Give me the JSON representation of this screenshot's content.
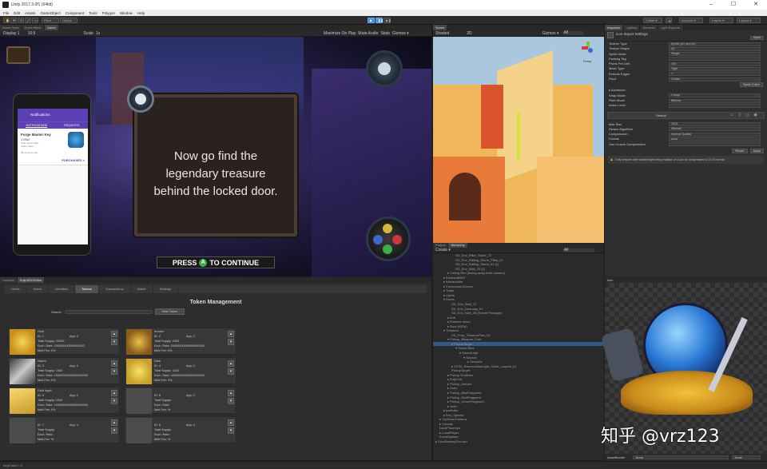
{
  "window": {
    "title": "Unity 2017.3.0f1 (64bit)"
  },
  "menu": [
    "File",
    "Edit",
    "Assets",
    "GameObject",
    "Component",
    "Tools",
    "Polygon",
    "Window",
    "Help"
  ],
  "toolbar": {
    "pivot": "Pivot",
    "global": "Global",
    "collab": "Collab ▾",
    "account": "Account ▾",
    "layers": "Layers ▾",
    "layout": "Layout ▾"
  },
  "tabs_left": [
    "Asset Store",
    "Audio Mixer",
    "Game"
  ],
  "game": {
    "display": "Display 1",
    "aspect": "16:9",
    "scale": "Scale",
    "scale_value": "1x",
    "options": [
      "Maximize On Play",
      "Mute Audio",
      "Stats",
      "Gizmos ▾"
    ],
    "dialog_lines": [
      "Now go find the",
      "legendary treasure",
      "behind the locked door."
    ],
    "press_prefix": "PRESS",
    "press_button": "A",
    "press_suffix": "TO CONTINUE",
    "phone": {
      "title": "Notifications",
      "tabs": [
        "NOTIFICATIONS",
        "REQUESTS"
      ],
      "item_title": "Forge Master Key",
      "item_price": "1 ENJ",
      "item_line1": "Hide Game Filter",
      "item_line2": "Settle value",
      "time": "48 seconds ago",
      "status": "PURCHASED >"
    }
  },
  "scene": {
    "tab": "Scene",
    "mode": "Shaded",
    "view2d": "2D",
    "gizmos": "Gizmos ▾",
    "search": "All",
    "persp": "Persp"
  },
  "inspector": {
    "tab": "Inspector",
    "tab2": "Lighting",
    "tab3": "Services",
    "tab4": "Light Explorer",
    "title": "icon Import Settings",
    "open": "Open",
    "rows": [
      {
        "label": "Texture Type",
        "value": "Sprite (2D and UI)"
      },
      {
        "label": "Texture Shape",
        "value": "2D"
      },
      {
        "label": "Sprite Mode",
        "value": "Single"
      },
      {
        "label": "Packing Tag",
        "value": ""
      },
      {
        "label": "Pixels Per Unit",
        "value": "100"
      },
      {
        "label": "Mesh Type",
        "value": "Tight"
      },
      {
        "label": "Extrude Edges",
        "value": "1"
      },
      {
        "label": "Pivot",
        "value": "Center"
      }
    ],
    "sprite_editor": "Sprite Editor",
    "advanced": "▸ Advanced",
    "rows2": [
      {
        "label": "Wrap Mode",
        "value": "Clamp"
      },
      {
        "label": "Filter Mode",
        "value": "Bilinear"
      },
      {
        "label": "Aniso Level",
        "value": ""
      }
    ],
    "default": "Default",
    "rows3": [
      {
        "label": "Max Size",
        "value": "1024"
      },
      {
        "label": "Resize Algorithm",
        "value": "Mitchell"
      },
      {
        "label": "Compression",
        "value": "Normal Quality"
      },
      {
        "label": "Format",
        "value": "Auto"
      },
      {
        "label": "Use Crunch Compression",
        "value": ""
      }
    ],
    "revert": "Revert",
    "apply": "Apply",
    "warning": "Only textures with width/height being multiple of 4 can be compressed to DXT5 format",
    "preview_label": "icon",
    "assetbundle": "AssetBundle",
    "assetbundle_value": "None",
    "assetbundle_value2": "None"
  },
  "hierarchy": {
    "tab": "Project",
    "tab2": "Hierarchy",
    "create": "Create ▾",
    "search": "All",
    "rows": [
      {
        "t": "SD_Env_Pillar_Stone_72",
        "i": 5
      },
      {
        "t": "SD_Env_Railing_Stone_Pillar_01",
        "i": 5
      },
      {
        "t": "SD_Env_Railing_Stone_01 (1)",
        "i": 5
      },
      {
        "t": "SD_Env_Wall_70 (1)",
        "i": 5
      },
      {
        "t": "▸ Ceiling Rim (facing away from camera)",
        "i": 3
      },
      {
        "t": "▸ EnchantMINT",
        "i": 2
      },
      {
        "t": "▸ Interactable",
        "i": 2
      },
      {
        "t": "▸ EnvironmentZones",
        "i": 2
      },
      {
        "t": "▸ Traps",
        "i": 2
      },
      {
        "t": "▸ Lights",
        "i": 2
      },
      {
        "t": "▾ Doors",
        "i": 2
      },
      {
        "t": "SD_Env_Wall_74",
        "i": 4
      },
      {
        "t": "SD_Env_Doorway_01",
        "i": 4
      },
      {
        "t": "SD_Env_Wall_36 (Secret Passage)",
        "i": 4
      },
      {
        "t": "▸ Exit",
        "i": 3
      },
      {
        "t": "▸ Endless doors",
        "i": 3
      },
      {
        "t": "▸ Door (KEW)",
        "i": 3
      },
      {
        "t": "▾ Treasure",
        "i": 2
      },
      {
        "t": "SD_Prop_TreasurePad_04",
        "i": 4
      },
      {
        "t": "▾ Pickup_Weapon_Fork",
        "i": 3
      },
      {
        "t": "▾ PickupTarget",
        "i": 4
      },
      {
        "t": "▾ Sword Blue",
        "i": 5
      },
      {
        "t": "▾ SwordLegit",
        "i": 6
      },
      {
        "t": "▾ Swords",
        "i": 7
      },
      {
        "t": "▸ Sword2s",
        "i": 8
      },
      {
        "t": "▸ CFX3_ResurrectionLight_Circle_Looped (2)",
        "i": 4
      },
      {
        "t": "PickupTarget",
        "i": 4
      },
      {
        "t": "▸ Pickup Godlines",
        "i": 3
      },
      {
        "t": "▸ Enjin Ink",
        "i": 3
      },
      {
        "t": "▸ Pickup_Amulet",
        "i": 3
      },
      {
        "t": "▸ Gold",
        "i": 3
      },
      {
        "t": "▸ Pickup_BlueFragment",
        "i": 3
      },
      {
        "t": "▸ Pickup_RedFragment",
        "i": 3
      },
      {
        "t": "▸ Pickup_GreenFragment",
        "i": 3
      },
      {
        "t": "▸ Gold",
        "i": 3
      },
      {
        "t": "▸ particles",
        "i": 2
      },
      {
        "t": "▸ Ens_Special",
        "i": 2
      },
      {
        "t": "▸ TopDownCamera",
        "i": 1
      },
      {
        "t": "▸ Canvas",
        "i": 1
      },
      {
        "t": "DockPlaceSys",
        "i": 1
      },
      {
        "t": "▸ LocalPlayer",
        "i": 1
      },
      {
        "t": "EventSystem",
        "i": 1
      },
      {
        "t": "▸ DontDestroyOnLoad",
        "i": 0
      }
    ]
  },
  "bottom": {
    "tabs": [
      "Console",
      "EnjinSDKEditor"
    ],
    "subtabs": [
      "Home",
      "Users",
      "Identities",
      "Tokens",
      "Transactions",
      "Wallet",
      "Settings"
    ],
    "active_subtab": "Tokens",
    "heading": "Token Management",
    "search_label": "Search",
    "new_token": "New Token",
    "cards": [
      {
        "name": "Gold",
        "id": "ID: 1",
        "app": "App: 2",
        "supply": "Total Supply: 20000",
        "rate": "Exch. Rate: 100000000000000000",
        "melt": "Melt Fee: 0%",
        "thumb": "coin"
      },
      {
        "name": "Amulet",
        "id": "ID: 2",
        "app": "App: 2",
        "supply": "Total Supply: 1000",
        "rate": "Exch. Rate: 20000000000000000000",
        "melt": "Melt Fee: 0%",
        "thumb": "amulet"
      },
      {
        "name": "Sword",
        "id": "ID: 3",
        "app": "App: 2",
        "supply": "Total Supply: 1000",
        "rate": "Exch. Rate: 15000000000000000000",
        "melt": "Melt Fee: 0%",
        "thumb": "sword"
      },
      {
        "name": "Dark",
        "id": "ID: 4",
        "app": "App: 2",
        "supply": "Total Supply: 1000",
        "rate": "Exch. Rate: 40000000000000000000",
        "melt": "Melt Fee: 0%",
        "thumb": "dice"
      },
      {
        "name": "Gold Ingot",
        "id": "ID: 5",
        "app": "App: 2",
        "supply": "Total Supply: 1000",
        "rate": "Exch. Rate: 10000000000000000000",
        "melt": "Melt Fee: 0%",
        "thumb": "ingot"
      },
      {
        "name": "",
        "id": "ID: 6",
        "app": "App: 2",
        "supply": "Total Supply:",
        "rate": "Exch. Rate:",
        "melt": "Melt Fee: %",
        "thumb": ""
      },
      {
        "name": "",
        "id": "ID: 7",
        "app": "App: 4",
        "supply": "Total Supply:",
        "rate": "Exch. Rate:",
        "melt": "Melt Fee: %",
        "thumb": ""
      },
      {
        "name": "",
        "id": "ID: 8",
        "app": "App: 4",
        "supply": "Total Supply:",
        "rate": "Exch. Rate:",
        "melt": "Melt Fee: %",
        "thumb": ""
      }
    ]
  },
  "status": {
    "text": "KeyCount = 2"
  },
  "watermark": {
    "text": "知乎 @vrz123"
  },
  "colors": {
    "accent": "#3a72b0",
    "play": "#4a90d9"
  }
}
